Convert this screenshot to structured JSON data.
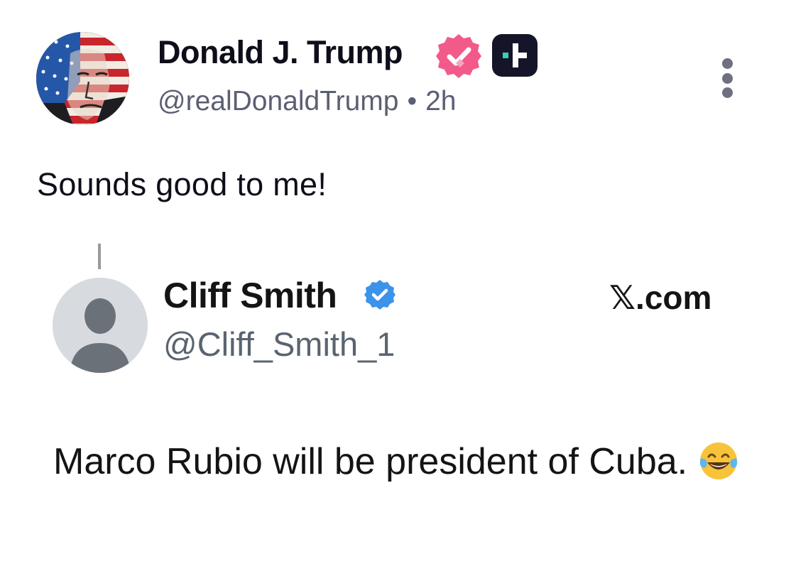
{
  "post": {
    "author_name": "Donald J. Trump",
    "author_handle": "@realDonaldTrump",
    "separator": "•",
    "time_ago": "2h",
    "text": "Sounds good to me!"
  },
  "quoted": {
    "name": "Cliff Smith",
    "handle": "@Cliff_Smith_1",
    "source": "𝕏.com",
    "text": "Marco Rubio will be president of Cuba."
  },
  "icons": {
    "verified_main": "verified-badge-icon",
    "plus": "truth-plus-icon",
    "more": "more-vertical-icon",
    "verified_quoted": "verified-check-icon",
    "emoji": "tears-of-joy-emoji-icon"
  },
  "colors": {
    "verified_main": "#f25a8a",
    "plus_badge": "#15152a",
    "plus_accent": "#2fd3b5",
    "verified_quoted": "#3d92ea",
    "meta_text": "#5b5f72"
  }
}
